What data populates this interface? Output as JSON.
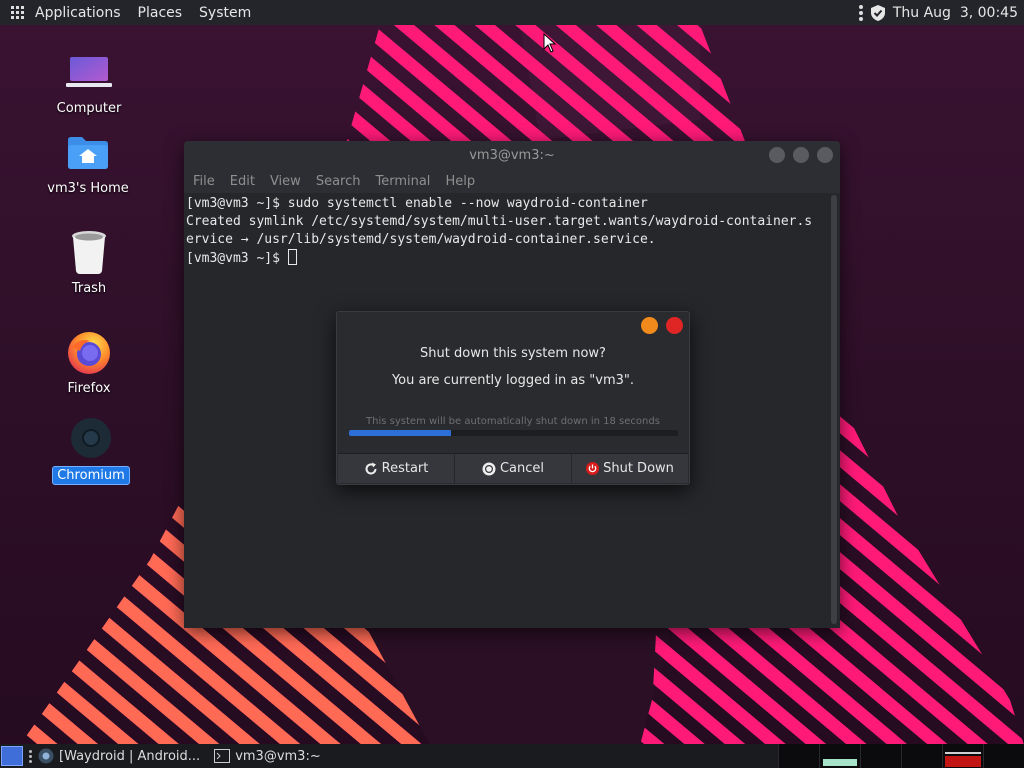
{
  "top_panel": {
    "menus": [
      "Applications",
      "Places",
      "System"
    ],
    "datetime": "Thu Aug  3, 00:45"
  },
  "desktop_icons": [
    {
      "label": "Computer",
      "icon": "computer-icon"
    },
    {
      "label": "vm3's Home",
      "icon": "home-folder-icon"
    },
    {
      "label": "Trash",
      "icon": "trash-icon"
    },
    {
      "label": "Firefox",
      "icon": "firefox-icon"
    },
    {
      "label": "Chromium",
      "icon": "chromium-icon",
      "selected": true
    }
  ],
  "terminal": {
    "title": "vm3@vm3:~",
    "menu": [
      "File",
      "Edit",
      "View",
      "Search",
      "Terminal",
      "Help"
    ],
    "lines": [
      "[vm3@vm3 ~]$ sudo systemctl enable --now waydroid-container",
      "Created symlink /etc/systemd/system/multi-user.target.wants/waydroid-container.s",
      "ervice → /usr/lib/systemd/system/waydroid-container.service."
    ],
    "prompt": "[vm3@vm3 ~]$ "
  },
  "dialog": {
    "title": "Shut down this system now?",
    "subtitle": "You are currently logged in as \"vm3\".",
    "countdown": "This system will be automatically shut down in 18 seconds",
    "progress": 0.31,
    "buttons": {
      "restart": "Restart",
      "cancel": "Cancel",
      "shutdown": "Shut Down"
    }
  },
  "taskbar": {
    "tasks": [
      {
        "label": "[Waydroid | Android...",
        "icon": "chromium-icon"
      },
      {
        "label": "vm3@vm3:~",
        "icon": "terminal-icon"
      }
    ]
  },
  "colors": {
    "accent": "#1f7ae8",
    "progress": "#2d6fd6",
    "dialog_orange": "#f08a1c",
    "dialog_red": "#e02525",
    "wallpaper_pink": "#ff1f7a",
    "wallpaper_orange": "#ff9a2a"
  }
}
